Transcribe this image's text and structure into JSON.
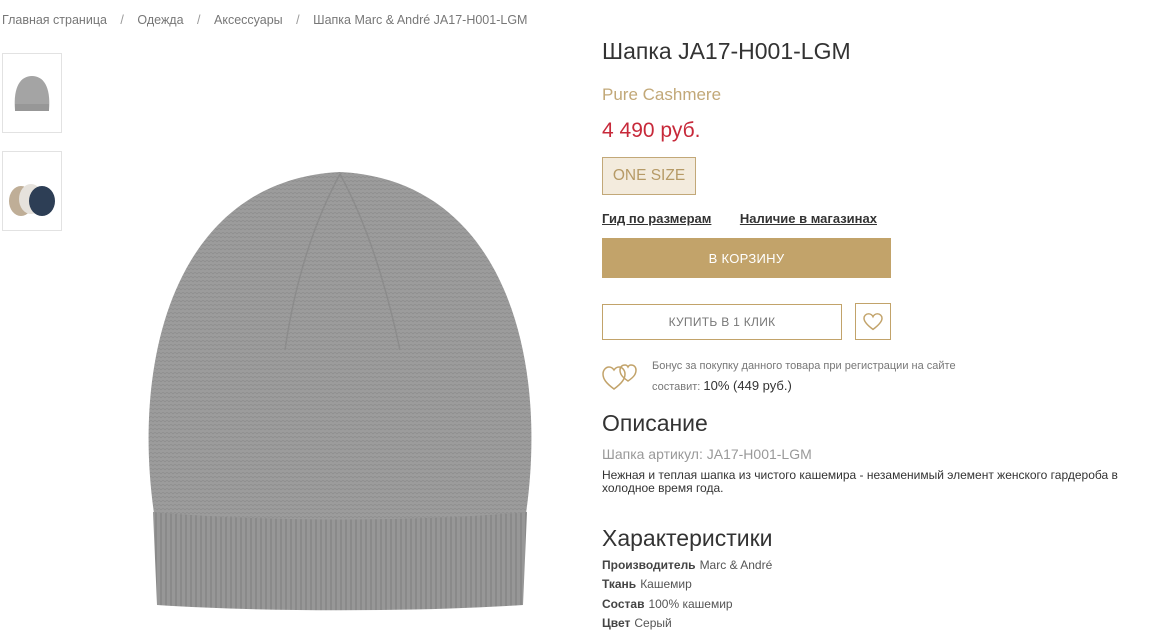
{
  "breadcrumb": {
    "items": [
      "Главная страница",
      "Одежда",
      "Аксессуары",
      "Шапка Marc & André JA17-H001-LGM"
    ],
    "separator": "/"
  },
  "product": {
    "title": "Шапка JA17-H001-LGM",
    "brand": "Pure Cashmere",
    "price": "4 490 руб.",
    "size": "ONE SIZE",
    "size_guide_link": "Гид по размерам",
    "availability_link": "Наличие в магазинах",
    "add_to_cart_label": "В КОРЗИНУ",
    "buy_one_click_label": "КУПИТЬ В 1 КЛИК",
    "wishlist_icon": "heart-icon"
  },
  "bonus": {
    "text": "Бонус за покупку данного товара при регистрации на сайте составит:",
    "value": "10% (449 руб.)",
    "icon": "hearts-icon"
  },
  "description": {
    "heading": "Описание",
    "article": "Шапка артикул: JA17-H001-LGM",
    "text": "Нежная и теплая шапка из чистого кашемира - незаменимый элемент женского гардероба в холодное время года."
  },
  "characteristics": {
    "heading": "Характеристики",
    "rows": [
      {
        "label": "Производитель",
        "value": "Marc & André"
      },
      {
        "label": "Ткань",
        "value": "Кашемир"
      },
      {
        "label": "Состав",
        "value": "100% кашемир"
      },
      {
        "label": "Цвет",
        "value": "Серый"
      }
    ]
  },
  "colors": {
    "accent": "#c2a36a",
    "price": "#c7293a",
    "brand": "#c2a878",
    "hat": "#9a9a9a"
  }
}
